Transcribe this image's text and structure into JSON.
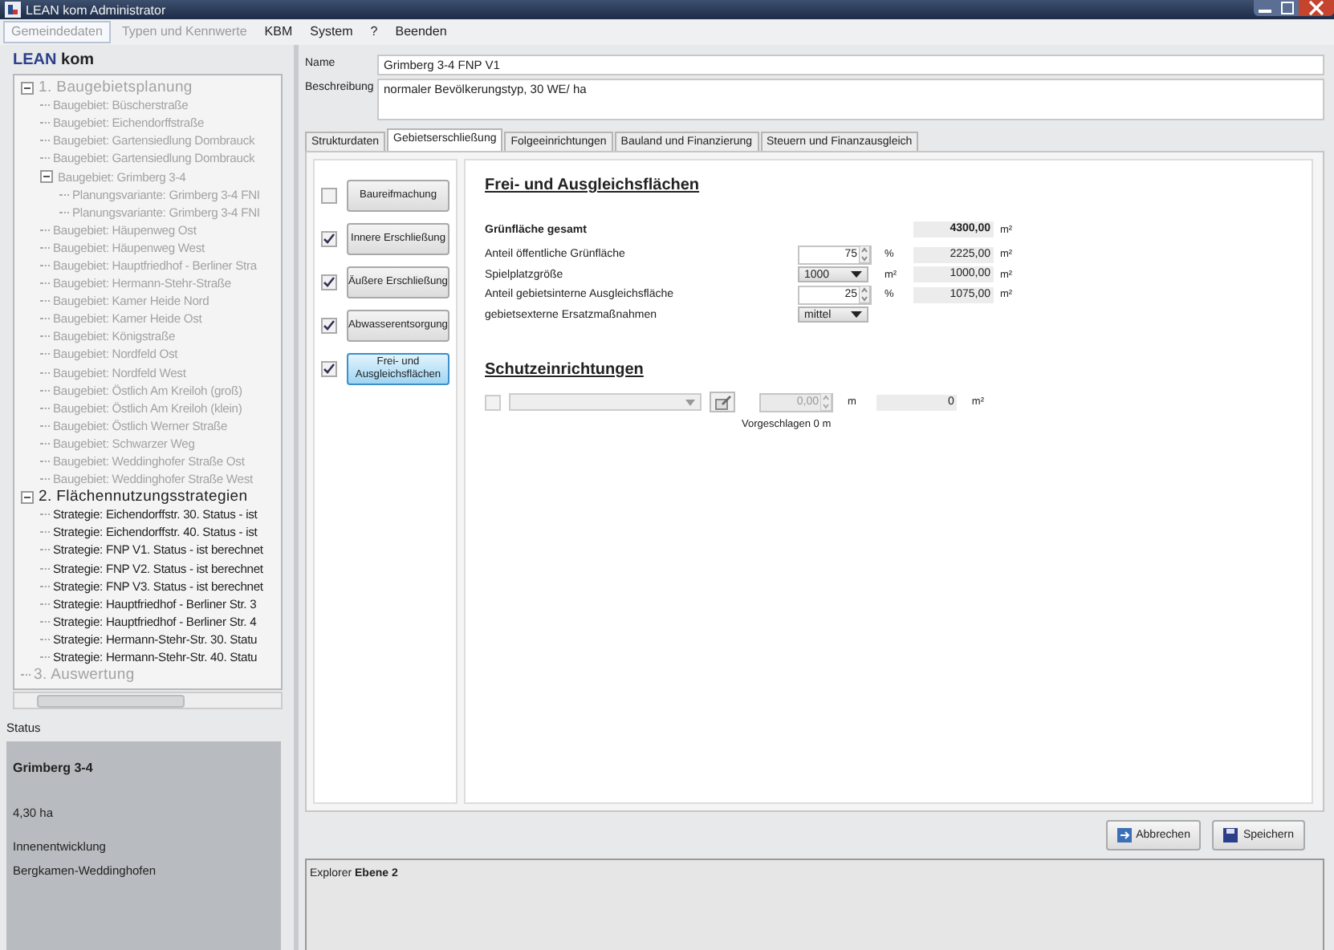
{
  "window": {
    "title": "LEAN kom Administrator"
  },
  "menu": [
    {
      "label": "Gemeindedaten",
      "selected": true,
      "disabled": true
    },
    {
      "label": "Typen und Kennwerte",
      "selected": false,
      "disabled": true
    },
    {
      "label": "KBM",
      "selected": false,
      "disabled": false
    },
    {
      "label": "System",
      "selected": false,
      "disabled": false
    },
    {
      "label": "?",
      "selected": false,
      "disabled": false
    },
    {
      "label": "Beenden",
      "selected": false,
      "disabled": false
    }
  ],
  "logo": {
    "part_1": "LEAN",
    "part_2": "kom"
  },
  "tree": [
    {
      "label": "1. Baugebietsplanung",
      "disabled": true,
      "expanded": true,
      "children": [
        {
          "label": "Baugebiet: Büscherstraße",
          "disabled": true
        },
        {
          "label": "Baugebiet: Eichendorffstraße",
          "disabled": true
        },
        {
          "label": "Baugebiet: Gartensiedlung Dombrauck",
          "disabled": true
        },
        {
          "label": "Baugebiet: Gartensiedlung Dombrauck",
          "disabled": true
        },
        {
          "label": "Baugebiet: Grimberg 3-4",
          "disabled": true,
          "expanded": true,
          "children": [
            {
              "label": "Planungsvariante: Grimberg 3-4 FNI",
              "disabled": true
            },
            {
              "label": "Planungsvariante: Grimberg 3-4 FNI",
              "disabled": true
            }
          ]
        },
        {
          "label": "Baugebiet: Häupenweg Ost",
          "disabled": true
        },
        {
          "label": "Baugebiet: Häupenweg West",
          "disabled": true
        },
        {
          "label": "Baugebiet: Hauptfriedhof - Berliner Stra",
          "disabled": true
        },
        {
          "label": "Baugebiet: Hermann-Stehr-Straße",
          "disabled": true
        },
        {
          "label": "Baugebiet: Kamer Heide Nord",
          "disabled": true
        },
        {
          "label": "Baugebiet: Kamer Heide Ost",
          "disabled": true
        },
        {
          "label": "Baugebiet: Königstraße",
          "disabled": true
        },
        {
          "label": "Baugebiet: Nordfeld Ost",
          "disabled": true
        },
        {
          "label": "Baugebiet: Nordfeld West",
          "disabled": true
        },
        {
          "label": "Baugebiet: Östlich Am Kreiloh (groß)",
          "disabled": true
        },
        {
          "label": "Baugebiet: Östlich Am Kreiloh (klein)",
          "disabled": true
        },
        {
          "label": "Baugebiet: Östlich Werner Straße",
          "disabled": true
        },
        {
          "label": "Baugebiet: Schwarzer Weg",
          "disabled": true
        },
        {
          "label": "Baugebiet: Weddinghofer Straße Ost",
          "disabled": true
        },
        {
          "label": "Baugebiet: Weddinghofer Straße West",
          "disabled": true
        }
      ]
    },
    {
      "label": "2. Flächennutzungsstrategien",
      "disabled": false,
      "expanded": true,
      "children": [
        {
          "label": "Strategie: Eichendorffstr. 30. Status - ist",
          "disabled": false
        },
        {
          "label": "Strategie: Eichendorffstr. 40. Status - ist",
          "disabled": false
        },
        {
          "label": "Strategie: FNP V1. Status - ist berechnet",
          "disabled": false
        },
        {
          "label": "Strategie: FNP V2. Status - ist berechnet",
          "disabled": false
        },
        {
          "label": "Strategie: FNP V3. Status - ist berechnet",
          "disabled": false
        },
        {
          "label": "Strategie: Hauptfriedhof - Berliner Str. 3",
          "disabled": false
        },
        {
          "label": "Strategie: Hauptfriedhof - Berliner Str. 4",
          "disabled": false
        },
        {
          "label": "Strategie: Hermann-Stehr-Str. 30. Statu",
          "disabled": false
        },
        {
          "label": "Strategie: Hermann-Stehr-Str. 40. Statu",
          "disabled": false
        }
      ]
    },
    {
      "label": "3. Auswertung",
      "disabled": true
    }
  ],
  "status": {
    "heading": "Status",
    "title": "Grimberg 3-4",
    "lines": [
      "4,30 ha",
      "Innenentwicklung",
      "Bergkamen-Weddinghofen"
    ]
  },
  "form": {
    "name_label": "Name",
    "name_value": "Grimberg 3-4 FNP V1",
    "description_label": "Beschreibung",
    "description_value": "normaler Bevölkerungstyp, 30 WE/ ha"
  },
  "tabs": [
    {
      "label": "Strukturdaten",
      "selected": false
    },
    {
      "label": "Gebietserschließung",
      "selected": true
    },
    {
      "label": "Folgeeinrichtungen",
      "selected": false
    },
    {
      "label": "Bauland und Finanzierung",
      "selected": false
    },
    {
      "label": "Steuern und Finanzausgleich",
      "selected": false
    }
  ],
  "steps": [
    {
      "label": "Baureifmachung",
      "checked": false,
      "selected": false
    },
    {
      "label": "Innere Erschließung",
      "checked": true,
      "selected": false
    },
    {
      "label": "Äußere Erschließung",
      "checked": true,
      "selected": false
    },
    {
      "label": "Abwasserentsorgung",
      "checked": true,
      "selected": false
    },
    {
      "label": "Frei- und Ausgleichsflächen",
      "checked": true,
      "selected": true
    }
  ],
  "section_1": {
    "title": "Frei- und Ausgleichsflächen",
    "rows": [
      {
        "kind": "total",
        "label": "Grünfläche gesamt",
        "result": "4300,00",
        "result_unit": "m²"
      },
      {
        "kind": "spin",
        "label": "Anteil öffentliche Grünfläche",
        "value": "75",
        "unit": "%",
        "result": "2225,00",
        "result_unit": "m²"
      },
      {
        "kind": "select",
        "label": "Spielplatzgröße",
        "value": "1000",
        "unit": "m²",
        "result": "1000,00",
        "result_unit": "m²"
      },
      {
        "kind": "spin",
        "label": "Anteil gebietsinterne Ausgleichsfläche",
        "value": "25",
        "unit": "%",
        "result": "1075,00",
        "result_unit": "m²"
      },
      {
        "kind": "select",
        "label": "gebietsexterne Ersatzmaßnahmen",
        "value": "mittel"
      }
    ]
  },
  "section_2": {
    "title": "Schutzeinrichtungen",
    "checked": false,
    "length": "0,00",
    "length_unit": "m",
    "result": "0",
    "result_unit": "m²",
    "hint": "Vorgeschlagen 0 m"
  },
  "buttons": [
    {
      "kind": "cancel",
      "label": "Abbrechen"
    },
    {
      "kind": "save",
      "label": "Speichern"
    }
  ],
  "explorer": {
    "label": "Explorer",
    "level": "Ebene 2"
  }
}
